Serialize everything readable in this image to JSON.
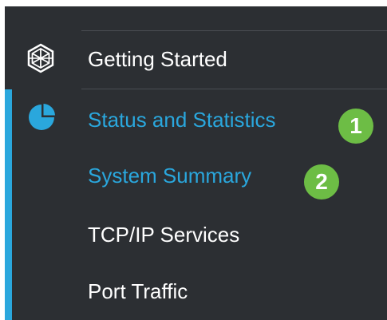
{
  "menu": {
    "getting_started": {
      "label": "Getting Started",
      "icon": "globe-icon"
    },
    "status_and_statistics": {
      "label": "Status and Statistics",
      "icon": "pie-chart-icon"
    },
    "system_summary": {
      "label": "System Summary"
    },
    "tcp_ip_services": {
      "label": "TCP/IP Services"
    },
    "port_traffic": {
      "label": "Port Traffic"
    }
  },
  "callouts": {
    "first": "1",
    "second": "2"
  },
  "colors": {
    "panel_background": "#2c2f33",
    "active_text": "#2aa7dd",
    "accent_bar": "#2aa7dd",
    "text": "#ffffff",
    "badge": "#6dbd45"
  }
}
